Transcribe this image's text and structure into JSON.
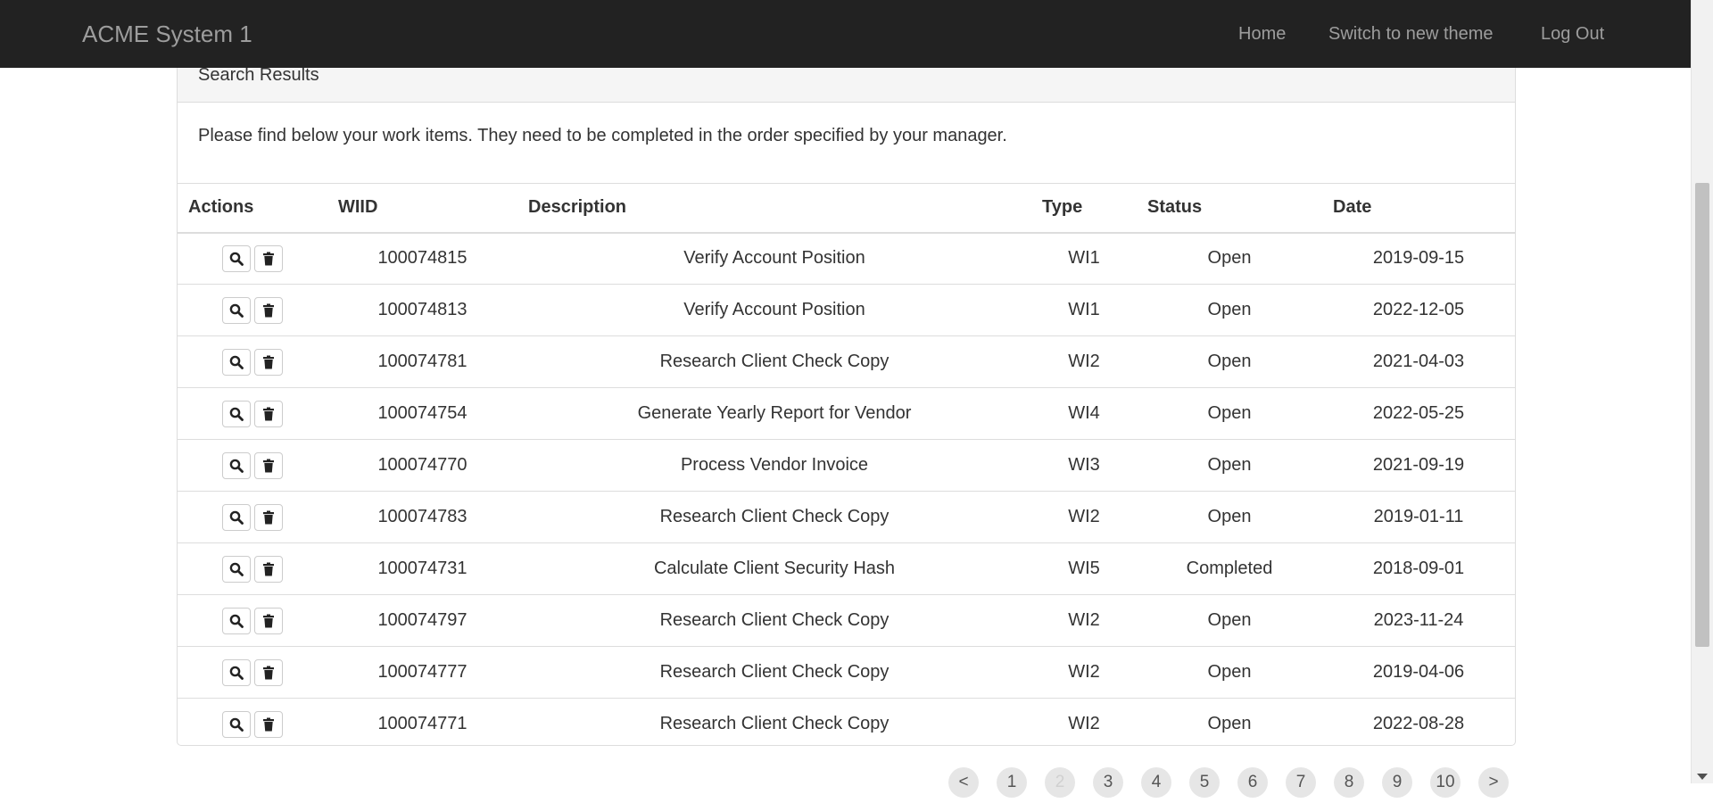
{
  "app": {
    "brand": "ACME System 1",
    "nav": {
      "home": "Home",
      "theme": "Switch to new theme",
      "logout": "Log Out"
    }
  },
  "panel": {
    "title": "Search Results",
    "intro": "Please find below your work items. They need to be completed in the order specified by your manager."
  },
  "table": {
    "headers": {
      "actions": "Actions",
      "wiid": "WIID",
      "description": "Description",
      "type": "Type",
      "status": "Status",
      "date": "Date"
    },
    "rows": [
      {
        "wiid": "100074815",
        "description": "Verify Account Position",
        "type": "WI1",
        "status": "Open",
        "date": "2019-09-15"
      },
      {
        "wiid": "100074813",
        "description": "Verify Account Position",
        "type": "WI1",
        "status": "Open",
        "date": "2022-12-05"
      },
      {
        "wiid": "100074781",
        "description": "Research Client Check Copy",
        "type": "WI2",
        "status": "Open",
        "date": "2021-04-03"
      },
      {
        "wiid": "100074754",
        "description": "Generate Yearly Report for Vendor",
        "type": "WI4",
        "status": "Open",
        "date": "2022-05-25"
      },
      {
        "wiid": "100074770",
        "description": "Process Vendor Invoice",
        "type": "WI3",
        "status": "Open",
        "date": "2021-09-19"
      },
      {
        "wiid": "100074783",
        "description": "Research Client Check Copy",
        "type": "WI2",
        "status": "Open",
        "date": "2019-01-11"
      },
      {
        "wiid": "100074731",
        "description": "Calculate Client Security Hash",
        "type": "WI5",
        "status": "Completed",
        "date": "2018-09-01"
      },
      {
        "wiid": "100074797",
        "description": "Research Client Check Copy",
        "type": "WI2",
        "status": "Open",
        "date": "2023-11-24"
      },
      {
        "wiid": "100074777",
        "description": "Research Client Check Copy",
        "type": "WI2",
        "status": "Open",
        "date": "2019-04-06"
      },
      {
        "wiid": "100074771",
        "description": "Research Client Check Copy",
        "type": "WI2",
        "status": "Open",
        "date": "2022-08-28"
      }
    ],
    "row_action_icons": [
      "search-icon",
      "trash-icon"
    ]
  },
  "pagination": {
    "prev": "<",
    "pages": [
      "1",
      "2",
      "3",
      "4",
      "5",
      "6",
      "7",
      "8",
      "9",
      "10"
    ],
    "current": "2",
    "next": ">"
  }
}
